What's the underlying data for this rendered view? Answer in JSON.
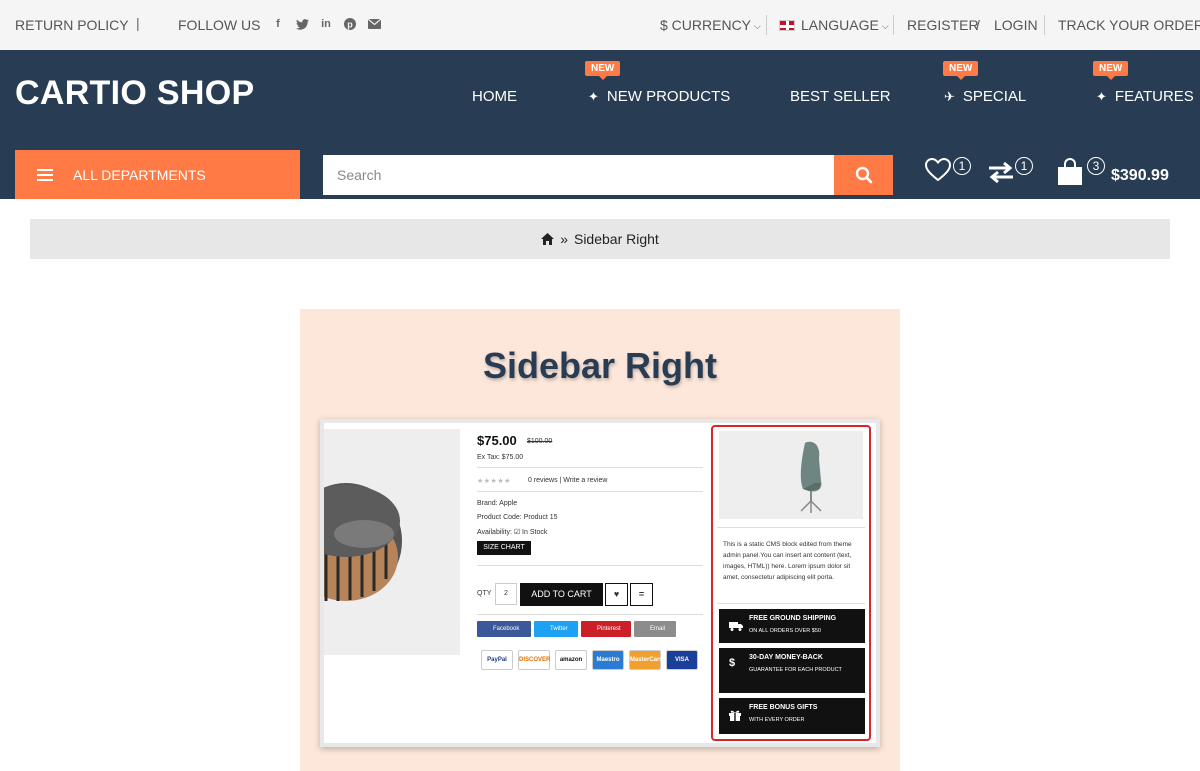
{
  "topbar": {
    "return_policy": "RETURN POLICY",
    "divider": "|",
    "follow_us": "FOLLOW US",
    "social_icons": [
      "facebook-icon",
      "twitter-icon",
      "linkedin-icon",
      "pinterest-icon",
      "email-icon"
    ],
    "currency": "$ CURRENCY",
    "language": "LANGUAGE",
    "register": "REGISTER",
    "slash": "/",
    "login": "LOGIN",
    "track_order": "TRACK YOUR ORDER"
  },
  "header": {
    "logo": "CARTIO SHOP",
    "nav": [
      {
        "label": "HOME",
        "badge": ""
      },
      {
        "label": "NEW PRODUCTS",
        "badge": "NEW"
      },
      {
        "label": "BEST SELLER",
        "badge": ""
      },
      {
        "label": "SPECIAL",
        "badge": "NEW"
      },
      {
        "label": "FEATURES",
        "badge": "NEW"
      }
    ],
    "departments": "ALL DEPARTMENTS",
    "search_placeholder": "Search",
    "wishlist_count": "1",
    "compare_count": "1",
    "cart_count": "3",
    "cart_total": "$390.99"
  },
  "breadcrumb": {
    "home_icon": "home-icon",
    "separator": "»",
    "current": "Sidebar Right"
  },
  "promo": {
    "title": "Sidebar Right",
    "product": {
      "price": "$75.00",
      "old_price": "$100.00",
      "ex_tax": "Ex Tax: $75.00",
      "reviews": "0 reviews | Write a review",
      "brand": "Brand: Apple",
      "code": "Product Code: Product 15",
      "availability": "Availability: ☑ In Stock",
      "size_chart": "SIZE CHART",
      "qty_label": "QTY",
      "qty_value": "2",
      "add_to_cart": "ADD TO CART",
      "share": [
        {
          "label": "Facebook",
          "color": "#3b5998"
        },
        {
          "label": "Twitter",
          "color": "#1da1f2"
        },
        {
          "label": "Pinterest",
          "color": "#cb2027"
        },
        {
          "label": "Email",
          "color": "#8c8c8c"
        }
      ],
      "payments": [
        "PayPal",
        "DISCOVER",
        "amazon",
        "Maestro",
        "MasterCard",
        "VISA"
      ]
    },
    "sidebar": {
      "cms_text": "This is a static CMS block edited from theme admin panel.You can insert ant content (text, images, HTML)) here. Lorem ipsum dolor sit amet, consectetur adipiscing elit porta.",
      "features": [
        {
          "icon": "truck-icon",
          "title": "FREE GROUND SHIPPING",
          "subtitle": "ON ALL ORDERS OVER $50"
        },
        {
          "icon": "dollar-icon",
          "title": "30-DAY MONEY-BACK",
          "subtitle": "GUARANTEE FOR EACH PRODUCT"
        },
        {
          "icon": "gift-icon",
          "title": "FREE BONUS GIFTS",
          "subtitle": "WITH EVERY ORDER"
        }
      ]
    }
  },
  "colors": {
    "accent": "#ff7a45",
    "header_bg": "#283d53",
    "promo_bg": "#fde6da",
    "sidebar_border": "#d8262b"
  }
}
